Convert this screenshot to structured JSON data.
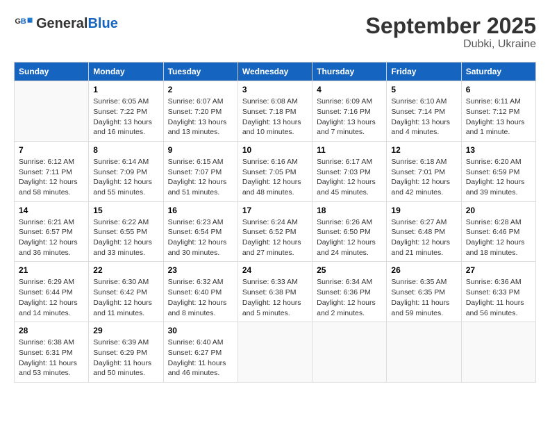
{
  "header": {
    "logo_line1": "General",
    "logo_line2": "Blue",
    "month": "September 2025",
    "location": "Dubki, Ukraine"
  },
  "days_of_week": [
    "Sunday",
    "Monday",
    "Tuesday",
    "Wednesday",
    "Thursday",
    "Friday",
    "Saturday"
  ],
  "weeks": [
    [
      {
        "day": "",
        "info": ""
      },
      {
        "day": "1",
        "info": "Sunrise: 6:05 AM\nSunset: 7:22 PM\nDaylight: 13 hours\nand 16 minutes."
      },
      {
        "day": "2",
        "info": "Sunrise: 6:07 AM\nSunset: 7:20 PM\nDaylight: 13 hours\nand 13 minutes."
      },
      {
        "day": "3",
        "info": "Sunrise: 6:08 AM\nSunset: 7:18 PM\nDaylight: 13 hours\nand 10 minutes."
      },
      {
        "day": "4",
        "info": "Sunrise: 6:09 AM\nSunset: 7:16 PM\nDaylight: 13 hours\nand 7 minutes."
      },
      {
        "day": "5",
        "info": "Sunrise: 6:10 AM\nSunset: 7:14 PM\nDaylight: 13 hours\nand 4 minutes."
      },
      {
        "day": "6",
        "info": "Sunrise: 6:11 AM\nSunset: 7:12 PM\nDaylight: 13 hours\nand 1 minute."
      }
    ],
    [
      {
        "day": "7",
        "info": "Sunrise: 6:12 AM\nSunset: 7:11 PM\nDaylight: 12 hours\nand 58 minutes."
      },
      {
        "day": "8",
        "info": "Sunrise: 6:14 AM\nSunset: 7:09 PM\nDaylight: 12 hours\nand 55 minutes."
      },
      {
        "day": "9",
        "info": "Sunrise: 6:15 AM\nSunset: 7:07 PM\nDaylight: 12 hours\nand 51 minutes."
      },
      {
        "day": "10",
        "info": "Sunrise: 6:16 AM\nSunset: 7:05 PM\nDaylight: 12 hours\nand 48 minutes."
      },
      {
        "day": "11",
        "info": "Sunrise: 6:17 AM\nSunset: 7:03 PM\nDaylight: 12 hours\nand 45 minutes."
      },
      {
        "day": "12",
        "info": "Sunrise: 6:18 AM\nSunset: 7:01 PM\nDaylight: 12 hours\nand 42 minutes."
      },
      {
        "day": "13",
        "info": "Sunrise: 6:20 AM\nSunset: 6:59 PM\nDaylight: 12 hours\nand 39 minutes."
      }
    ],
    [
      {
        "day": "14",
        "info": "Sunrise: 6:21 AM\nSunset: 6:57 PM\nDaylight: 12 hours\nand 36 minutes."
      },
      {
        "day": "15",
        "info": "Sunrise: 6:22 AM\nSunset: 6:55 PM\nDaylight: 12 hours\nand 33 minutes."
      },
      {
        "day": "16",
        "info": "Sunrise: 6:23 AM\nSunset: 6:54 PM\nDaylight: 12 hours\nand 30 minutes."
      },
      {
        "day": "17",
        "info": "Sunrise: 6:24 AM\nSunset: 6:52 PM\nDaylight: 12 hours\nand 27 minutes."
      },
      {
        "day": "18",
        "info": "Sunrise: 6:26 AM\nSunset: 6:50 PM\nDaylight: 12 hours\nand 24 minutes."
      },
      {
        "day": "19",
        "info": "Sunrise: 6:27 AM\nSunset: 6:48 PM\nDaylight: 12 hours\nand 21 minutes."
      },
      {
        "day": "20",
        "info": "Sunrise: 6:28 AM\nSunset: 6:46 PM\nDaylight: 12 hours\nand 18 minutes."
      }
    ],
    [
      {
        "day": "21",
        "info": "Sunrise: 6:29 AM\nSunset: 6:44 PM\nDaylight: 12 hours\nand 14 minutes."
      },
      {
        "day": "22",
        "info": "Sunrise: 6:30 AM\nSunset: 6:42 PM\nDaylight: 12 hours\nand 11 minutes."
      },
      {
        "day": "23",
        "info": "Sunrise: 6:32 AM\nSunset: 6:40 PM\nDaylight: 12 hours\nand 8 minutes."
      },
      {
        "day": "24",
        "info": "Sunrise: 6:33 AM\nSunset: 6:38 PM\nDaylight: 12 hours\nand 5 minutes."
      },
      {
        "day": "25",
        "info": "Sunrise: 6:34 AM\nSunset: 6:36 PM\nDaylight: 12 hours\nand 2 minutes."
      },
      {
        "day": "26",
        "info": "Sunrise: 6:35 AM\nSunset: 6:35 PM\nDaylight: 11 hours\nand 59 minutes."
      },
      {
        "day": "27",
        "info": "Sunrise: 6:36 AM\nSunset: 6:33 PM\nDaylight: 11 hours\nand 56 minutes."
      }
    ],
    [
      {
        "day": "28",
        "info": "Sunrise: 6:38 AM\nSunset: 6:31 PM\nDaylight: 11 hours\nand 53 minutes."
      },
      {
        "day": "29",
        "info": "Sunrise: 6:39 AM\nSunset: 6:29 PM\nDaylight: 11 hours\nand 50 minutes."
      },
      {
        "day": "30",
        "info": "Sunrise: 6:40 AM\nSunset: 6:27 PM\nDaylight: 11 hours\nand 46 minutes."
      },
      {
        "day": "",
        "info": ""
      },
      {
        "day": "",
        "info": ""
      },
      {
        "day": "",
        "info": ""
      },
      {
        "day": "",
        "info": ""
      }
    ]
  ]
}
